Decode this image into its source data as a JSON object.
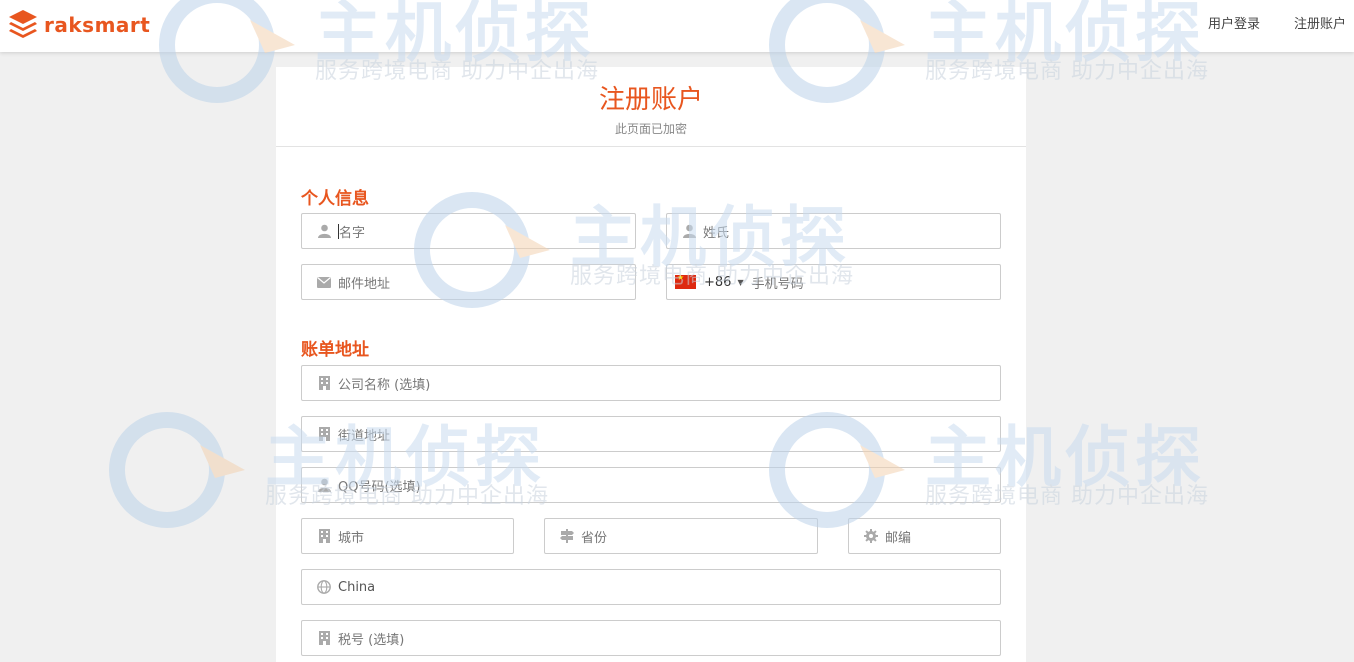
{
  "brand": {
    "name": "raksmart",
    "color": "#e8561f"
  },
  "nav": {
    "login": "用户登录",
    "register": "注册账户"
  },
  "page": {
    "title": "注册账户",
    "subtitle": "此页面已加密"
  },
  "sections": {
    "personal": "个人信息",
    "billing": "账单地址"
  },
  "fields": {
    "first_name": {
      "placeholder": "名字",
      "icon": "user-icon"
    },
    "last_name": {
      "placeholder": "姓氏",
      "icon": "user-icon"
    },
    "email": {
      "placeholder": "邮件地址",
      "icon": "envelope-icon"
    },
    "phone": {
      "dial_code": "+86",
      "placeholder": "手机号码",
      "icon": "china-flag-icon"
    },
    "company": {
      "placeholder": "公司名称 (选填)",
      "icon": "building-icon"
    },
    "street": {
      "placeholder": "街道地址",
      "icon": "building-icon"
    },
    "qq": {
      "placeholder": "QQ号码(选填)",
      "icon": "user-icon"
    },
    "city": {
      "placeholder": "城市",
      "icon": "building-icon"
    },
    "province": {
      "placeholder": "省份",
      "icon": "signpost-icon"
    },
    "postcode": {
      "placeholder": "邮编",
      "icon": "gear-icon"
    },
    "country": {
      "value": "China",
      "icon": "globe-icon"
    },
    "tax_id": {
      "placeholder": "税号 (选填)",
      "icon": "building-icon"
    }
  },
  "watermark": {
    "title": "主机侦探",
    "slogan": "服务跨境电商 助力中企出海"
  }
}
